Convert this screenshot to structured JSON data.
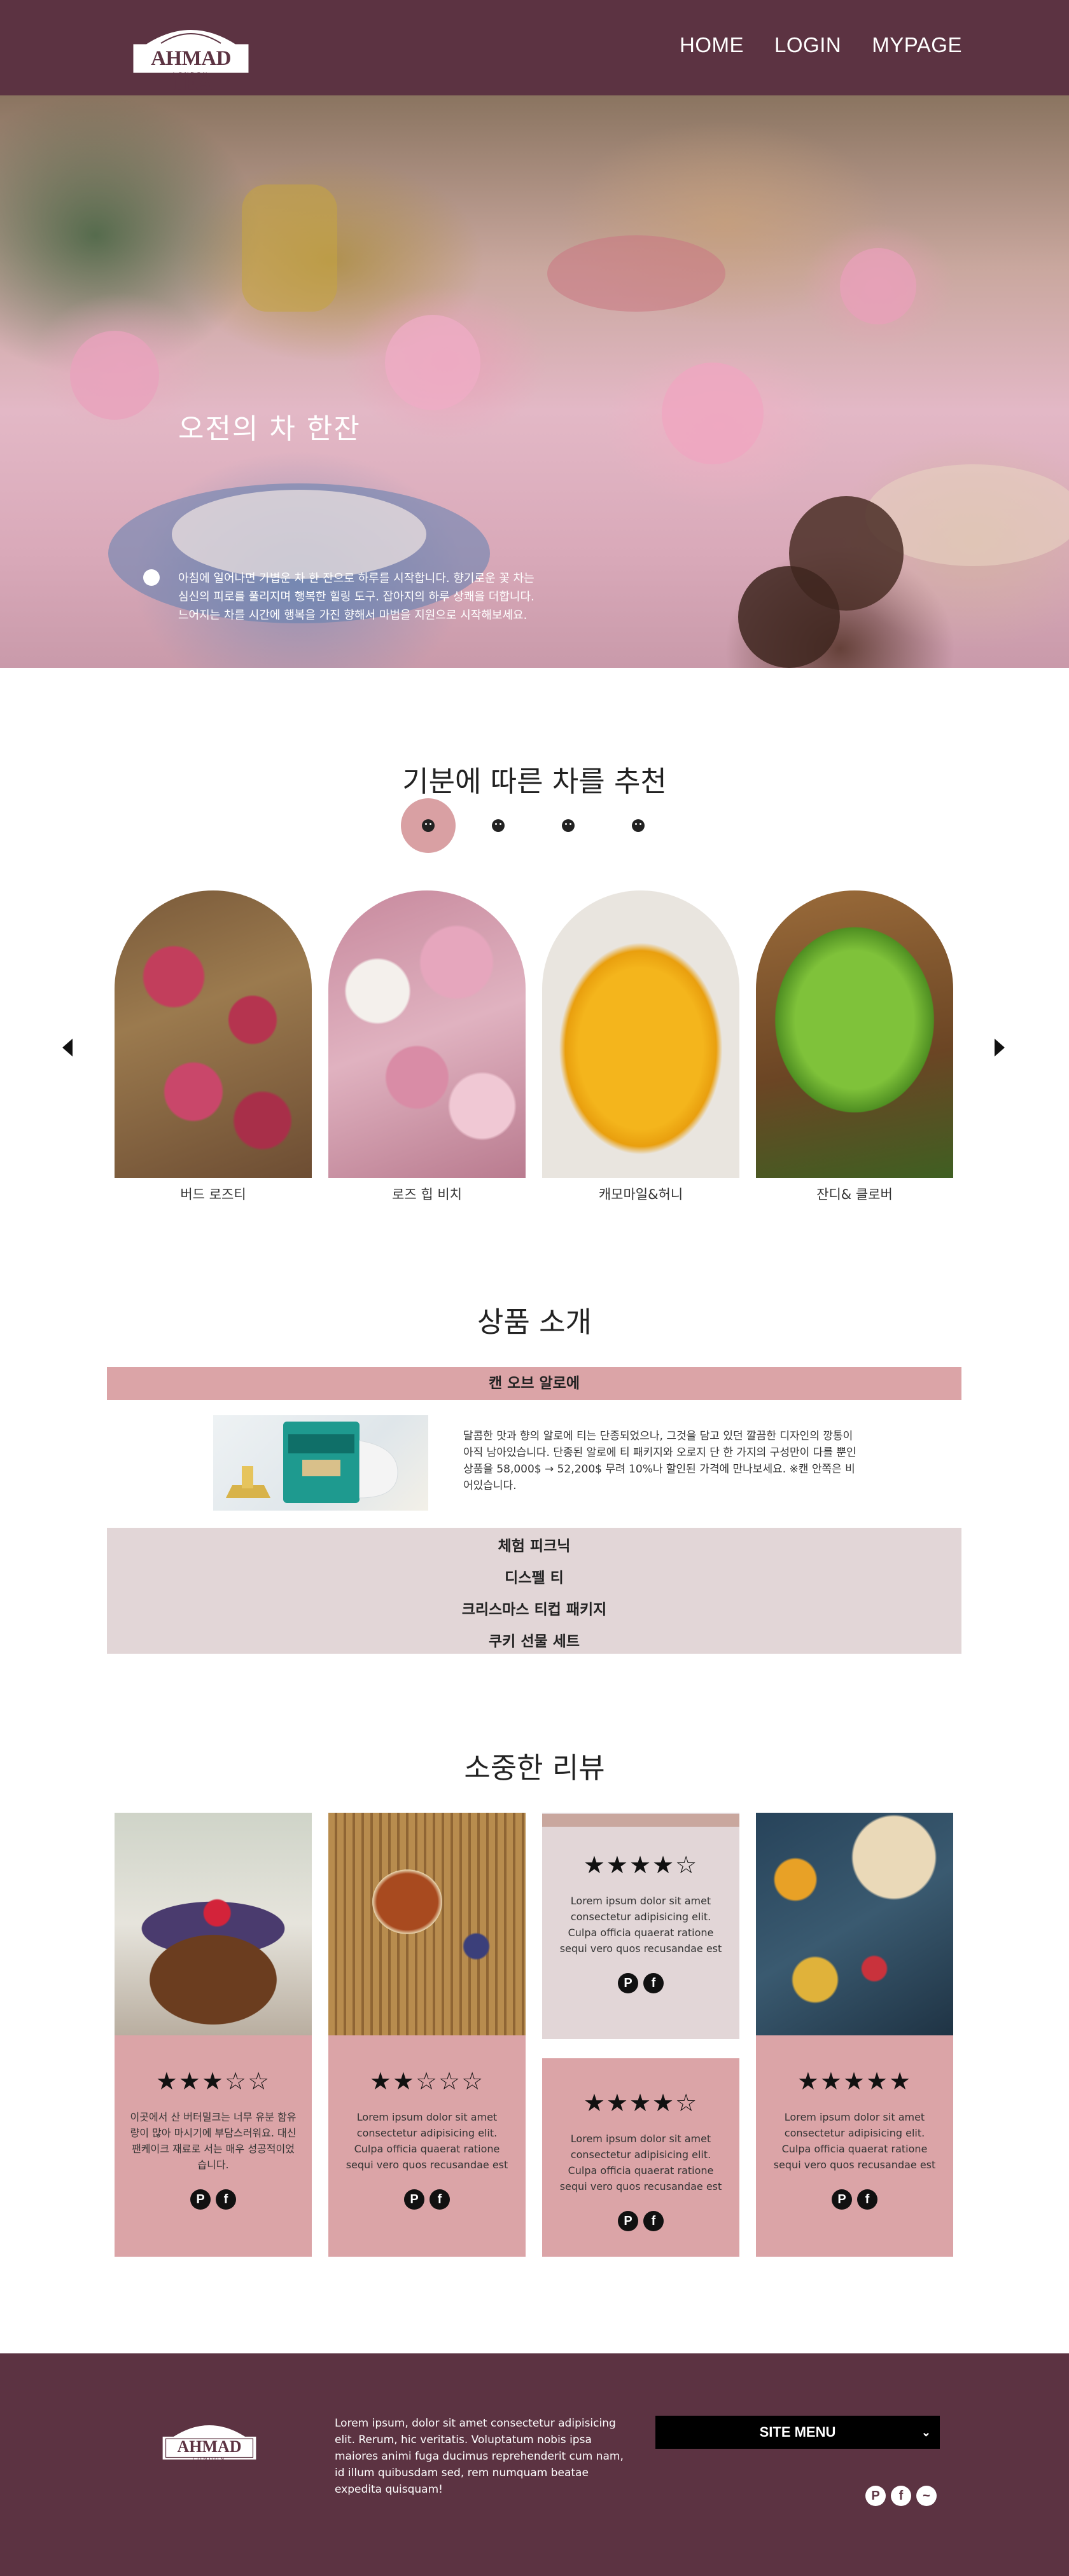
{
  "header": {
    "logo_text": "AHMAD TEA",
    "logo_sub": "LONDON",
    "nav": [
      "HOME",
      "LOGIN",
      "MYPAGE"
    ]
  },
  "hero": {
    "title": "오전의 차 한잔",
    "text": "아침에 일어나면 가볍운 차 한 잔으로 하루를 시작합니다. 향기로운 꽃 차는 심신의 피로를 풀리지며 행복한 힐링 도구. 잡아지의 하루 상쾌을 더합니다. 느어지는 차를 시간에 행복을 가진 향해서 마법을 지원으로 시작해보세요."
  },
  "recommend": {
    "title": "기분에 따른 차를 추천",
    "moods": [
      "mood-1",
      "mood-2",
      "mood-3",
      "mood-4"
    ],
    "teas": [
      {
        "name": "버드 로즈티"
      },
      {
        "name": "로즈 힙 비치"
      },
      {
        "name": "캐모마일&허니"
      },
      {
        "name": "잔디& 클로버"
      }
    ]
  },
  "products": {
    "title": "상품 소개",
    "active": "캔 오브 알로에",
    "description": "달콤한 맛과 향의 알로에 티는 단종되었으나, 그것을 담고 있던 깔끔한 디자인의 깡통이 아직 남아있습니다. 단종된 알로에 티 패키지와 오로지 단 한 가지의 구성만이 다를 뿐인 상품을 58,000$ → 52,200$ 무려 10%나 할인된 가격에 만나보세요. ※캔 안쪽은 비어있습니다.",
    "items": [
      "체험 피크닉",
      "디스펠 티",
      "크리스마스 티컵 패키지",
      "쿠키 선물 세트"
    ]
  },
  "reviews": {
    "title": "소중한 리뷰",
    "cards": [
      {
        "stars": "★★★☆☆",
        "text": "이곳에서 산 버터밀크는 너무 유분 함유량이 많아 마시기에 부담스러워요. 대신 팬케이크 재료로 서는 매우 성공적이었습니다."
      },
      {
        "stars": "★★☆☆☆",
        "text": "Lorem ipsum dolor sit amet consectetur adipisicing elit. Culpa officia quaerat ratione sequi vero quos recusandae est"
      },
      {
        "stars": "★★★★☆",
        "text": "Lorem ipsum dolor sit amet consectetur adipisicing elit. Culpa officia quaerat ratione sequi vero quos recusandae est"
      },
      {
        "stars": "★★★★☆",
        "text": "Lorem ipsum dolor sit amet consectetur adipisicing elit. Culpa officia quaerat ratione sequi vero quos recusandae est"
      },
      {
        "stars": "★★★★★",
        "text": "Lorem ipsum dolor sit amet consectetur adipisicing elit. Culpa officia quaerat ratione sequi vero quos recusandae est"
      }
    ]
  },
  "footer": {
    "logo_text": "AHMAD TEA",
    "logo_sub": "LONDON",
    "text": "Lorem ipsum, dolor sit amet consectetur adipisicing elit. Rerum, hic veritatis. Voluptatum nobis ipsa maiores animi fuga ducimus reprehenderit cum nam, id illum quibusdam sed, rem numquam beatae expedita quisquam!",
    "site_menu": "SITE MENU"
  },
  "icons": {
    "pinterest": "pinterest-icon",
    "facebook": "facebook-icon",
    "messenger": "messenger-icon"
  },
  "colors": {
    "primary": "#5c3342",
    "accent": "#dba4a7",
    "muted": "#e2d6d7"
  }
}
